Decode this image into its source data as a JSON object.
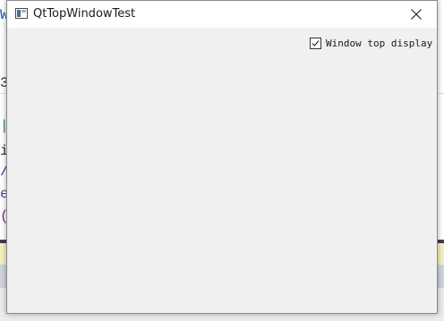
{
  "window": {
    "title": "QtTopWindowTest",
    "close_icon": "close-icon",
    "app_icon": "window-icon"
  },
  "client": {
    "checkbox": {
      "label": "Window top display",
      "checked": true
    }
  },
  "colors": {
    "client_bg": "#f0f0f0",
    "titlebar_bg": "#ffffff"
  }
}
